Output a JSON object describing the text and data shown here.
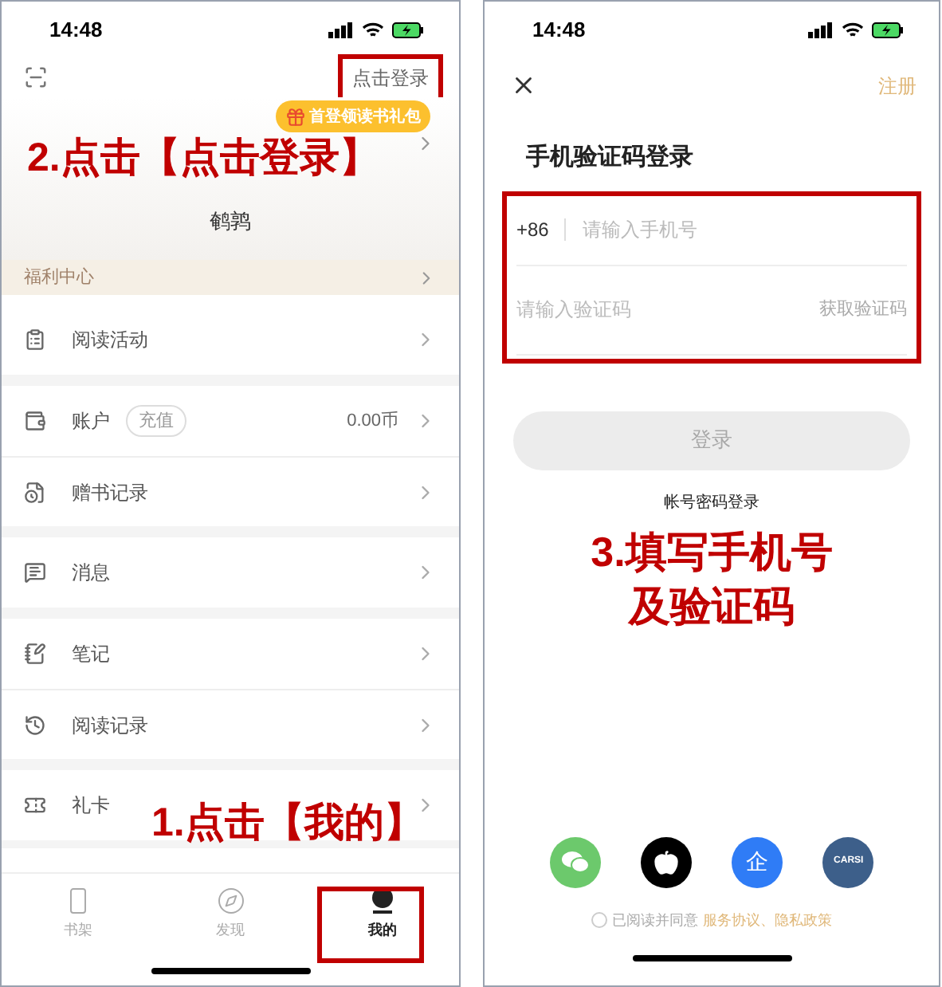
{
  "left_screen": {
    "status_bar": {
      "time": "14:48"
    },
    "login_link": "点击登录",
    "gift_badge": "首登领读书礼包",
    "username": "鹌鹑",
    "welfare_center": "福利中心",
    "menu_sections": [
      {
        "items": [
          {
            "label": "阅读活动"
          }
        ]
      },
      {
        "items": [
          {
            "label": "账户",
            "badge": "充值",
            "value": "0.00币"
          },
          {
            "label": "赠书记录"
          }
        ]
      },
      {
        "items": [
          {
            "label": "消息"
          }
        ]
      },
      {
        "items": [
          {
            "label": "笔记"
          },
          {
            "label": "阅读记录"
          }
        ]
      },
      {
        "items": [
          {
            "label": "礼卡"
          }
        ]
      }
    ],
    "tabs": [
      {
        "label": "书架",
        "selected": false
      },
      {
        "label": "发现",
        "selected": false
      },
      {
        "label": "我的",
        "selected": true
      }
    ]
  },
  "right_screen": {
    "status_bar": {
      "time": "14:48"
    },
    "register_link": "注册",
    "title": "手机验证码登录",
    "country_code": "+86",
    "phone_field": {
      "placeholder": "请输入手机号"
    },
    "code_field": {
      "placeholder": "请输入验证码"
    },
    "get_code_button": "获取验证码",
    "login_button": {
      "label": "登录",
      "disabled": true
    },
    "password_login_link": "帐号密码登录",
    "social_logins": [
      {
        "kind": "wechat"
      },
      {
        "kind": "apple"
      },
      {
        "kind": "enterprise",
        "label": "企"
      },
      {
        "kind": "carsi",
        "label": "CARSI"
      }
    ],
    "agreement": {
      "checked": false,
      "text": "已阅读并同意",
      "links": "服务协议、隐私政策"
    }
  },
  "annotations": [
    {
      "text": "2.点击【点击登录】"
    },
    {
      "text": "1.点击【我的】"
    },
    {
      "lines": [
        "3.填写手机号",
        "及验证码"
      ]
    }
  ]
}
